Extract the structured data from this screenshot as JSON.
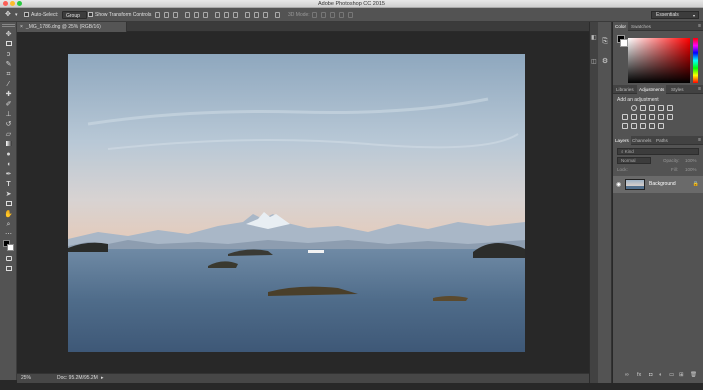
{
  "window": {
    "title": "Adobe Photoshop CC 2015"
  },
  "options_bar": {
    "auto_select_label": "Auto-Select:",
    "auto_select_value": "Group",
    "transform_controls_label": "Show Transform Controls",
    "mode_3d_label": "3D Mode:"
  },
  "workspace": {
    "label": "Essentials"
  },
  "document": {
    "tab_label": "_MG_1786.dng @ 25% (RGB/16)",
    "zoom": "25%",
    "doc_size": "Doc: 95.2M/95.2M"
  },
  "panels": {
    "color_tabs": [
      "Color",
      "Swatches"
    ],
    "adjustment_tabs": [
      "Libraries",
      "Adjustments",
      "Styles"
    ],
    "adjustments_heading": "Add an adjustment",
    "layers_tabs": [
      "Layers",
      "Channels",
      "Paths"
    ],
    "filter_placeholder": "Kind",
    "blend_mode": "Normal",
    "opacity_label": "Opacity:",
    "opacity_value": "100%",
    "lock_label": "Lock:",
    "fill_label": "Fill:",
    "fill_value": "100%",
    "layer_name": "Background"
  },
  "tools": [
    "move-tool",
    "marquee-tool",
    "lasso-tool",
    "quick-select-tool",
    "crop-tool",
    "eyedropper-tool",
    "healing-brush-tool",
    "brush-tool",
    "clone-stamp-tool",
    "history-brush-tool",
    "eraser-tool",
    "gradient-tool",
    "blur-tool",
    "dodge-tool",
    "pen-tool",
    "type-tool",
    "path-select-tool",
    "rectangle-tool",
    "hand-tool",
    "zoom-tool",
    "edit-toolbar",
    "colors",
    "quick-mask",
    "screen-mode"
  ],
  "colors": {
    "accent_panel": "#535353",
    "canvas_bg": "#282828"
  }
}
